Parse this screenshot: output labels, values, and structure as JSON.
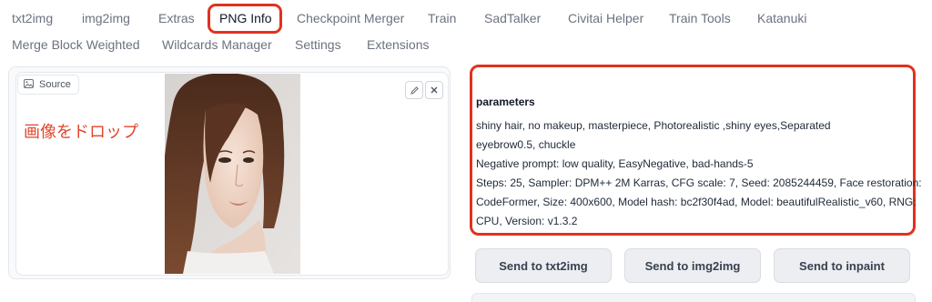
{
  "tabs": {
    "row1": [
      "txt2img",
      "img2img",
      "Extras",
      "PNG Info",
      "Checkpoint Merger",
      "Train",
      "SadTalker",
      "Civitai Helper",
      "Train Tools",
      "Katanuki"
    ],
    "row2": [
      "Merge Block Weighted",
      "Wildcards Manager",
      "Settings",
      "Extensions"
    ],
    "active": "PNG Info"
  },
  "source": {
    "label": "Source",
    "drop_text": "画像をドロップ",
    "icons": [
      "image-icon",
      "edit-icon",
      "close-icon"
    ]
  },
  "info": {
    "heading": "parameters",
    "lines": [
      "shiny hair, no makeup, masterpiece, Photorealistic ,shiny eyes,Separated",
      "eyebrow0.5, chuckle",
      "Negative prompt: low quality, EasyNegative, bad-hands-5",
      "Steps: 25, Sampler: DPM++ 2M Karras, CFG scale: 7, Seed: 2085244459, Face restoration:",
      "CodeFormer, Size: 400x600, Model hash: bc2f30f4ad, Model: beautifulRealistic_v60, RNG:",
      "CPU, Version: v1.3.2"
    ]
  },
  "buttons": [
    "Send to txt2img",
    "Send to img2img",
    "Send to inpaint"
  ],
  "colors": {
    "highlight": "#e0321f",
    "drop_text": "#e0452b"
  }
}
